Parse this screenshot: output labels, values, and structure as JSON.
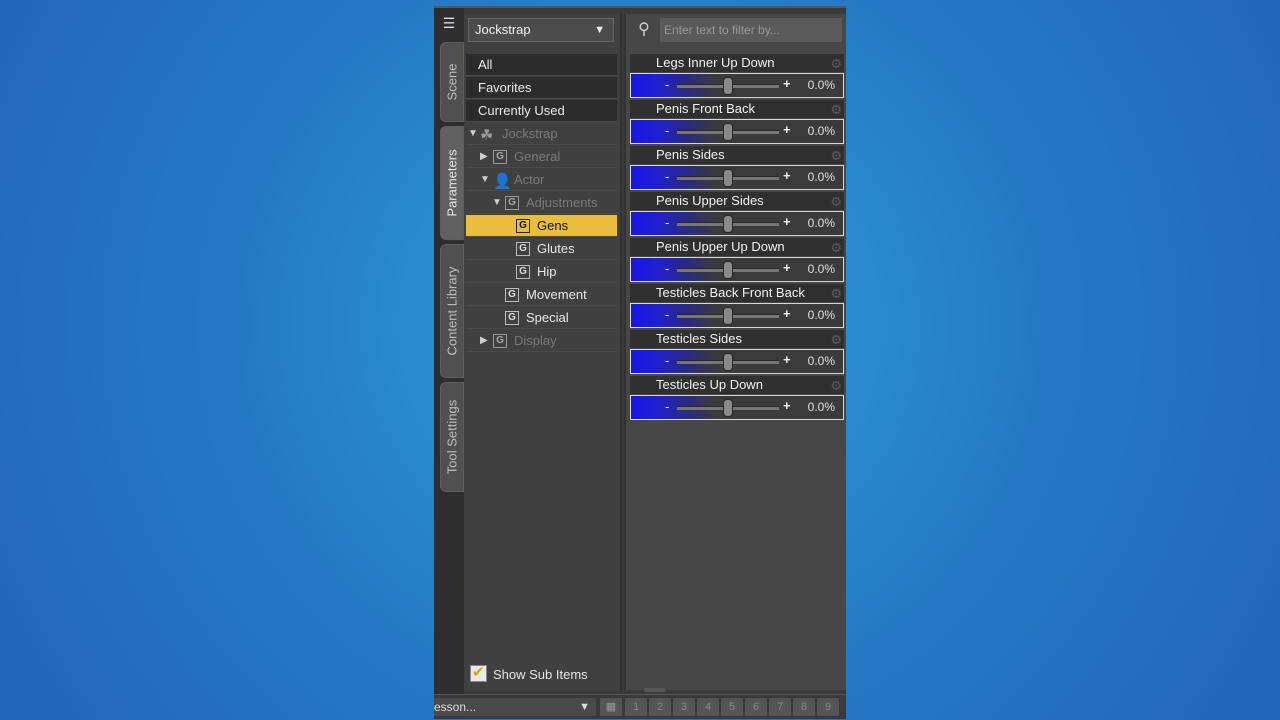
{
  "side_tabs": [
    "Scene",
    "Parameters",
    "Content Library",
    "Tool Settings"
  ],
  "node_dropdown": {
    "value": "Jockstrap"
  },
  "top_items": [
    "All",
    "Favorites",
    "Currently Used"
  ],
  "tree": {
    "root": "Jockstrap",
    "general": "General",
    "actor": "Actor",
    "adjustments": "Adjustments",
    "gens": "Gens",
    "glutes": "Glutes",
    "hip": "Hip",
    "movement": "Movement",
    "special": "Special",
    "display": "Display",
    "g_glyph": "G"
  },
  "show_sub_items": {
    "label": "Show Sub Items",
    "checked": true
  },
  "filter": {
    "placeholder": "Enter text to filter by..."
  },
  "params": [
    {
      "name": "Legs Inner Up Down",
      "value": "0.0%"
    },
    {
      "name": "Penis Front Back",
      "value": "0.0%"
    },
    {
      "name": "Penis Sides",
      "value": "0.0%"
    },
    {
      "name": "Penis Upper Sides",
      "value": "0.0%"
    },
    {
      "name": "Penis Upper Up Down",
      "value": "0.0%"
    },
    {
      "name": "Testicles Back Front Back",
      "value": "0.0%"
    },
    {
      "name": "Testicles Sides",
      "value": "0.0%"
    },
    {
      "name": "Testicles Up Down",
      "value": "0.0%"
    }
  ],
  "slider_symbols": {
    "minus": "-",
    "plus": "+"
  },
  "bottom": {
    "lesson": "esson...",
    "numbers": [
      "1",
      "2",
      "3",
      "4",
      "5",
      "6",
      "7",
      "8",
      "9"
    ]
  },
  "colors": {
    "accent": "#e8be3c",
    "slider_blue": "#1717e6",
    "background": "#2579c4"
  }
}
